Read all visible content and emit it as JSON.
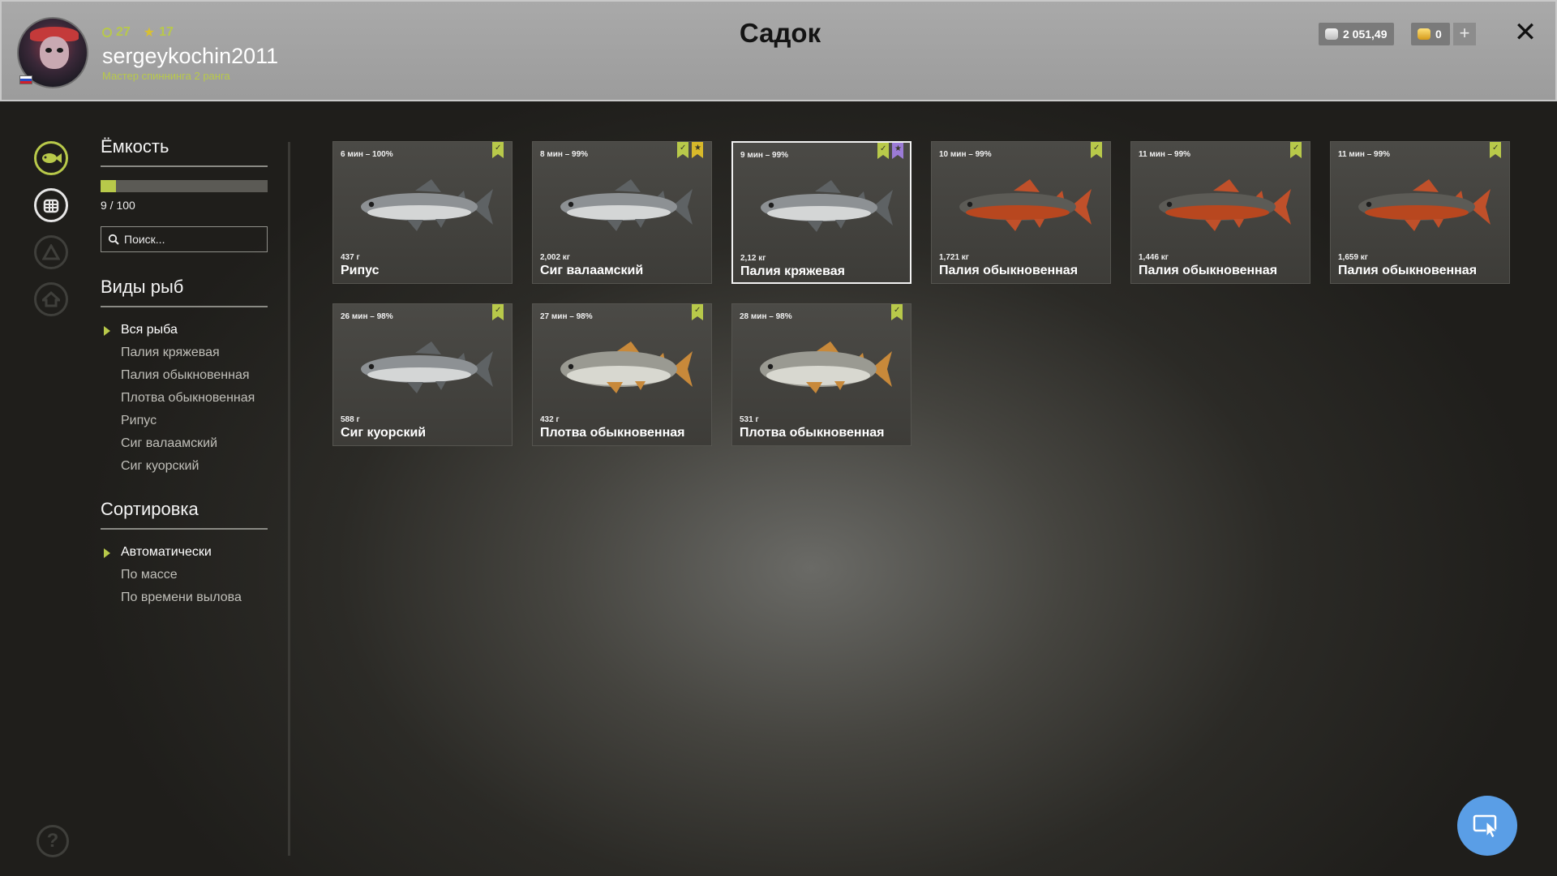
{
  "header": {
    "title": "Садок",
    "level": "27",
    "stars": "17",
    "username": "sergeykochin2011",
    "rank": "Мастер спиннинга 2 ранга",
    "silver": "2 051,49",
    "gold": "0",
    "plus": "+",
    "close": "✕"
  },
  "capacity": {
    "title": "Ёмкость",
    "used": 9,
    "total": 100,
    "fill_fraction": 0.09,
    "text": "9 / 100"
  },
  "search": {
    "placeholder": "Поиск..."
  },
  "species": {
    "title": "Виды рыб",
    "items": [
      {
        "label": "Вся рыба",
        "selected": true
      },
      {
        "label": "Палия кряжевая",
        "selected": false
      },
      {
        "label": "Палия обыкновенная",
        "selected": false
      },
      {
        "label": "Плотва обыкновенная",
        "selected": false
      },
      {
        "label": "Рипус",
        "selected": false
      },
      {
        "label": "Сиг валаамский",
        "selected": false
      },
      {
        "label": "Сиг куорский",
        "selected": false
      }
    ]
  },
  "sorting": {
    "title": "Сортировка",
    "items": [
      {
        "label": "Автоматически",
        "selected": true
      },
      {
        "label": "По массе",
        "selected": false
      },
      {
        "label": "По времени вылова",
        "selected": false
      }
    ]
  },
  "fish": [
    {
      "meta": "6 мин – 100%",
      "weight": "437 г",
      "name": "Рипус",
      "type": "white",
      "marks": [
        "green"
      ],
      "selected": false
    },
    {
      "meta": "8 мин – 99%",
      "weight": "2,002 кг",
      "name": "Сиг валаамский",
      "type": "white",
      "marks": [
        "green",
        "star"
      ],
      "selected": false
    },
    {
      "meta": "9 мин – 99%",
      "weight": "2,12 кг",
      "name": "Палия кряжевая",
      "type": "white",
      "marks": [
        "green",
        "purple"
      ],
      "selected": true
    },
    {
      "meta": "10 мин – 99%",
      "weight": "1,721 кг",
      "name": "Палия обыкновенная",
      "type": "char",
      "marks": [
        "green"
      ],
      "selected": false
    },
    {
      "meta": "11 мин – 99%",
      "weight": "1,446 кг",
      "name": "Палия обыкновенная",
      "type": "char",
      "marks": [
        "green"
      ],
      "selected": false
    },
    {
      "meta": "11 мин – 99%",
      "weight": "1,659 кг",
      "name": "Палия обыкновенная",
      "type": "char",
      "marks": [
        "green"
      ],
      "selected": false
    },
    {
      "meta": "26 мин – 98%",
      "weight": "588 г",
      "name": "Сиг куорский",
      "type": "white",
      "marks": [
        "green"
      ],
      "selected": false
    },
    {
      "meta": "27 мин – 98%",
      "weight": "432 г",
      "name": "Плотва обыкновенная",
      "type": "roach",
      "marks": [
        "green"
      ],
      "selected": false
    },
    {
      "meta": "28 мин – 98%",
      "weight": "531 г",
      "name": "Плотва обыкновенная",
      "type": "roach",
      "marks": [
        "green"
      ],
      "selected": false
    }
  ],
  "colors": {
    "accent": "#b8c94a",
    "header_bg": "#a9a9a9",
    "card_bg": "#45443f",
    "cursor_button": "#5a9ee6"
  },
  "icons": {
    "rail": [
      "fish-icon",
      "keepnet-icon",
      "boat-icon",
      "home-icon"
    ],
    "help": "?"
  }
}
